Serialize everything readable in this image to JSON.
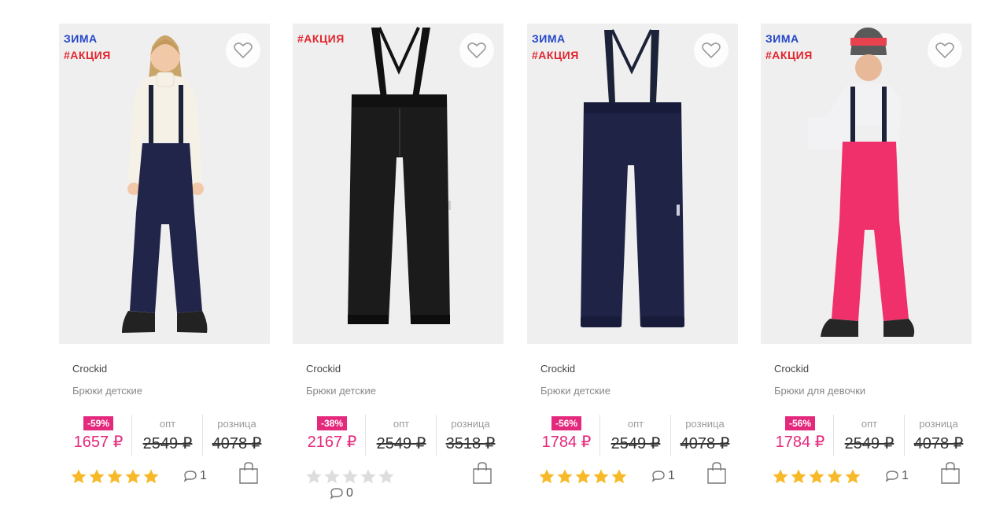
{
  "products": [
    {
      "tags": {
        "winter": "ЗИМА",
        "sale": "#АКЦИЯ"
      },
      "brand": "Crockid",
      "name": "Брюки детские",
      "discount": "-59%",
      "price_sale": "1657 ₽",
      "opt_label": "опт",
      "price_opt": "2549 ₽",
      "retail_label": "розница",
      "price_retail": "4078 ₽",
      "rating": 5,
      "comments": "1"
    },
    {
      "tags": {
        "winter": "",
        "sale": "#АКЦИЯ"
      },
      "brand": "Crockid",
      "name": "Брюки детские",
      "discount": "-38%",
      "price_sale": "2167 ₽",
      "opt_label": "опт",
      "price_opt": "2549 ₽",
      "retail_label": "розница",
      "price_retail": "3518 ₽",
      "rating": 0,
      "comments": "0"
    },
    {
      "tags": {
        "winter": "ЗИМА",
        "sale": "#АКЦИЯ"
      },
      "brand": "Crockid",
      "name": "Брюки детские",
      "discount": "-56%",
      "price_sale": "1784 ₽",
      "opt_label": "опт",
      "price_opt": "2549 ₽",
      "retail_label": "розница",
      "price_retail": "4078 ₽",
      "rating": 5,
      "comments": "1"
    },
    {
      "tags": {
        "winter": "ЗИМА",
        "sale": "#АКЦИЯ"
      },
      "brand": "Crockid",
      "name": "Брюки для девочки",
      "discount": "-56%",
      "price_sale": "1784 ₽",
      "opt_label": "опт",
      "price_opt": "2549 ₽",
      "retail_label": "розница",
      "price_retail": "4078 ₽",
      "rating": 5,
      "comments": "1"
    }
  ],
  "colors": {
    "accent": "#e4287c",
    "tag_winter": "#2346c8",
    "tag_sale": "#e0262d",
    "star_on": "#f7b928",
    "star_off": "#dddddd"
  },
  "icons": {
    "favorite": "heart-icon",
    "comments": "comment-bubble-icon",
    "cart": "shopping-bag-icon"
  }
}
